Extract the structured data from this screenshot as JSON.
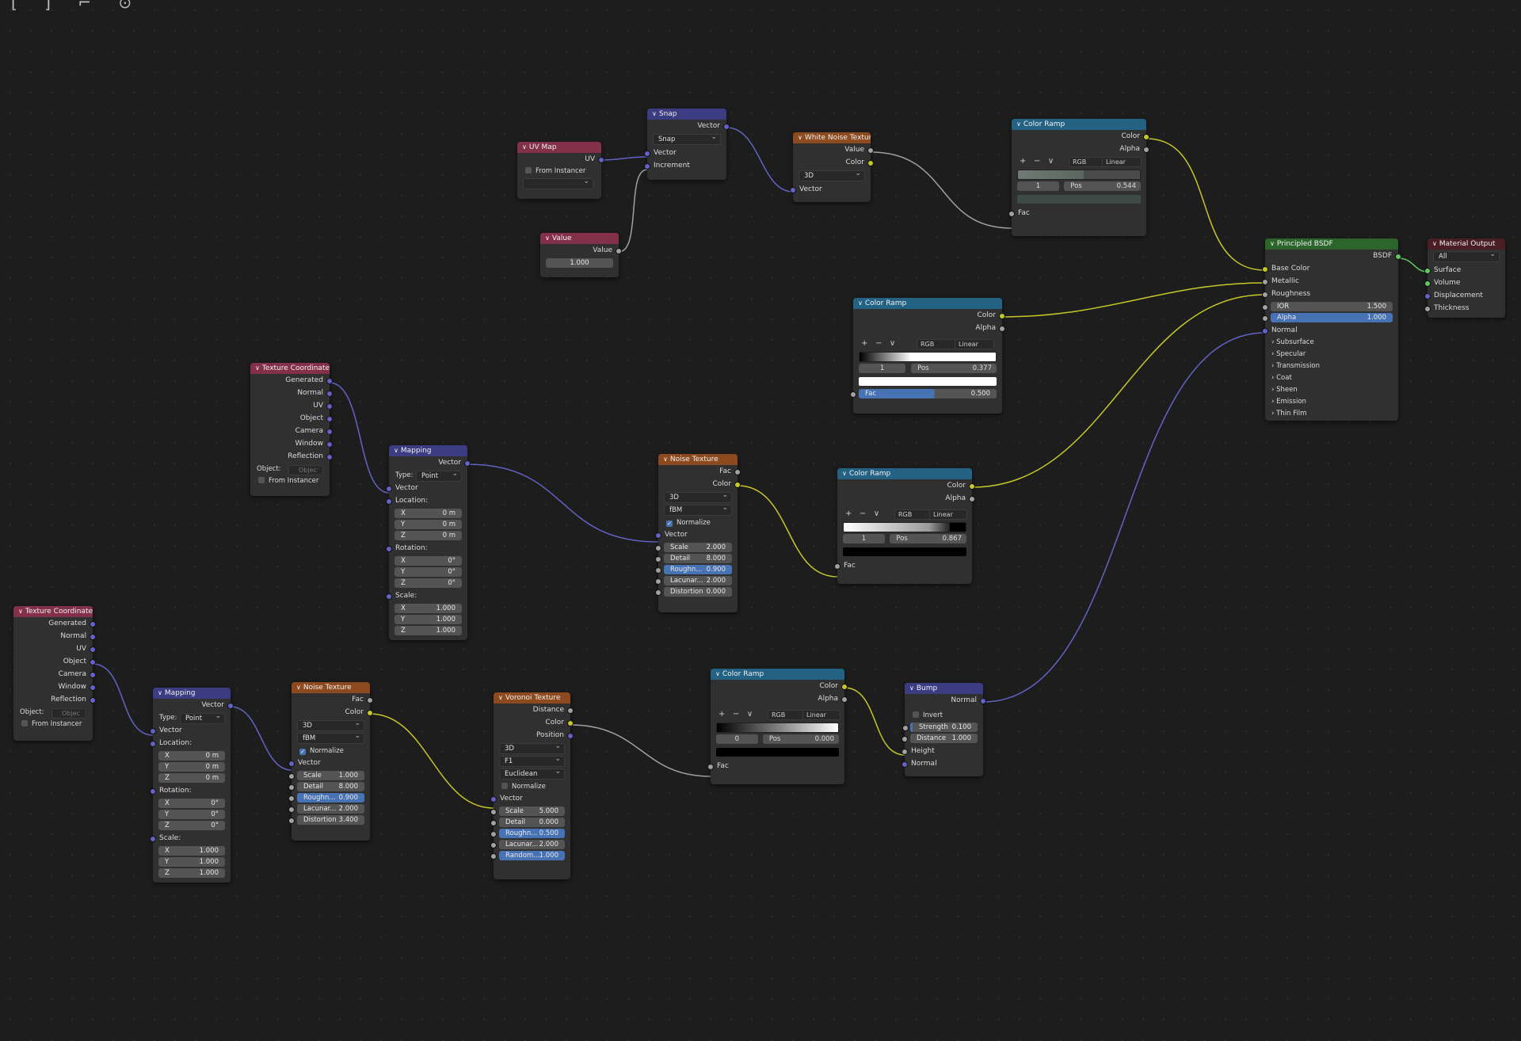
{
  "toolbar": {
    "icons": "[ ] ⌐ ⊙"
  },
  "colors": {
    "vector": "#6363c7",
    "color": "#c7c729",
    "float": "#a1a1a1",
    "shader": "#63c763"
  },
  "uvmap": {
    "title": "UV Map",
    "out_uv": "UV",
    "from_instancer": "From Instancer"
  },
  "value_node": {
    "title": "Value",
    "out_value": "Value",
    "value": "1.000"
  },
  "snap": {
    "title": "Snap",
    "out_vector": "Vector",
    "op": "Snap",
    "in_vector": "Vector",
    "in_increment": "Increment"
  },
  "whitenoise": {
    "title": "White Noise Texture",
    "out_value": "Value",
    "out_color": "Color",
    "dim": "3D",
    "in_vector": "Vector"
  },
  "ramp1": {
    "title": "Color Ramp",
    "out_color": "Color",
    "out_alpha": "Alpha",
    "plus": "+",
    "minus": "−",
    "mode": "RGB",
    "interp": "Linear",
    "index": "1",
    "pos_label": "Pos",
    "pos": "0.544",
    "in_fac": "Fac"
  },
  "ramp2": {
    "title": "Color Ramp",
    "out_color": "Color",
    "out_alpha": "Alpha",
    "plus": "+",
    "minus": "−",
    "mode": "RGB",
    "interp": "Linear",
    "index": "1",
    "pos_label": "Pos",
    "pos": "0.377",
    "in_fac": "Fac",
    "fac_value": "0.500"
  },
  "ramp3": {
    "title": "Color Ramp",
    "out_color": "Color",
    "out_alpha": "Alpha",
    "plus": "+",
    "minus": "−",
    "mode": "RGB",
    "interp": "Linear",
    "index": "1",
    "pos_label": "Pos",
    "pos": "0.867",
    "in_fac": "Fac"
  },
  "ramp4": {
    "title": "Color Ramp",
    "out_color": "Color",
    "out_alpha": "Alpha",
    "plus": "+",
    "minus": "−",
    "mode": "RGB",
    "interp": "Linear",
    "index": "0",
    "pos_label": "Pos",
    "pos": "0.000",
    "in_fac": "Fac"
  },
  "bsdf": {
    "title": "Principled BSDF",
    "out_bsdf": "BSDF",
    "base_color": "Base Color",
    "metallic": "Metallic",
    "roughness": "Roughness",
    "ior_label": "IOR",
    "ior": "1.500",
    "alpha_label": "Alpha",
    "alpha": "1.000",
    "normal": "Normal",
    "sections": [
      "Subsurface",
      "Specular",
      "Transmission",
      "Coat",
      "Sheen",
      "Emission",
      "Thin Film"
    ]
  },
  "matout": {
    "title": "Material Output",
    "target": "All",
    "surface": "Surface",
    "volume": "Volume",
    "displacement": "Displacement",
    "thickness": "Thickness"
  },
  "texcoord1": {
    "title": "Texture Coordinate",
    "outputs": [
      "Generated",
      "Normal",
      "UV",
      "Object",
      "Camera",
      "Window",
      "Reflection"
    ],
    "object_label": "Object:",
    "object_placeholder": "Objec",
    "from_instancer": "From Instancer"
  },
  "texcoord2": {
    "title": "Texture Coordinate",
    "outputs": [
      "Generated",
      "Normal",
      "UV",
      "Object",
      "Camera",
      "Window",
      "Reflection"
    ],
    "object_label": "Object:",
    "object_placeholder": "Objec",
    "from_instancer": "From Instancer"
  },
  "mapping1": {
    "title": "Mapping",
    "out_vector": "Vector",
    "type_label": "Type:",
    "type": "Point",
    "in_vector": "Vector",
    "location_label": "Location:",
    "location": [
      [
        "X",
        "0 m"
      ],
      [
        "Y",
        "0 m"
      ],
      [
        "Z",
        "0 m"
      ]
    ],
    "rotation_label": "Rotation:",
    "rotation": [
      [
        "X",
        "0°"
      ],
      [
        "Y",
        "0°"
      ],
      [
        "Z",
        "0°"
      ]
    ],
    "scale_label": "Scale:",
    "scale": [
      [
        "X",
        "1.000"
      ],
      [
        "Y",
        "1.000"
      ],
      [
        "Z",
        "1.000"
      ]
    ]
  },
  "mapping2": {
    "title": "Mapping",
    "out_vector": "Vector",
    "type_label": "Type:",
    "type": "Point",
    "in_vector": "Vector",
    "location_label": "Location:",
    "location": [
      [
        "X",
        "0 m"
      ],
      [
        "Y",
        "0 m"
      ],
      [
        "Z",
        "0 m"
      ]
    ],
    "rotation_label": "Rotation:",
    "rotation": [
      [
        "X",
        "0°"
      ],
      [
        "Y",
        "0°"
      ],
      [
        "Z",
        "0°"
      ]
    ],
    "scale_label": "Scale:",
    "scale": [
      [
        "X",
        "1.000"
      ],
      [
        "Y",
        "1.000"
      ],
      [
        "Z",
        "1.000"
      ]
    ]
  },
  "noise1": {
    "title": "Noise Texture",
    "out_fac": "Fac",
    "out_color": "Color",
    "dim": "3D",
    "type": "fBM",
    "normalize": "Normalize",
    "in_vector": "Vector",
    "params": [
      [
        "Scale",
        "2.000"
      ],
      [
        "Detail",
        "8.000"
      ],
      [
        "Roughn...",
        "0.900"
      ],
      [
        "Lacunar...",
        "2.000"
      ],
      [
        "Distortion",
        "0.000"
      ]
    ]
  },
  "noise2": {
    "title": "Noise Texture",
    "out_fac": "Fac",
    "out_color": "Color",
    "dim": "3D",
    "type": "fBM",
    "normalize": "Normalize",
    "in_vector": "Vector",
    "params": [
      [
        "Scale",
        "1.000"
      ],
      [
        "Detail",
        "8.000"
      ],
      [
        "Roughn...",
        "0.900"
      ],
      [
        "Lacunar...",
        "2.000"
      ],
      [
        "Distortion",
        "3.400"
      ]
    ]
  },
  "voronoi": {
    "title": "Voronoi Texture",
    "out_distance": "Distance",
    "out_color": "Color",
    "out_position": "Position",
    "dim": "3D",
    "feature": "F1",
    "metric": "Euclidean",
    "normalize": "Normalize",
    "in_vector": "Vector",
    "params": [
      [
        "Scale",
        "5.000"
      ],
      [
        "Detail",
        "0.000"
      ],
      [
        "Roughn...",
        "0.500"
      ],
      [
        "Lacunar...",
        "2.000"
      ],
      [
        "Random...",
        "1.000"
      ]
    ]
  },
  "bump": {
    "title": "Bump",
    "out_normal": "Normal",
    "invert": "Invert",
    "strength_label": "Strength",
    "strength": "0.100",
    "distance_label": "Distance",
    "distance": "1.000",
    "in_height": "Height",
    "in_normal": "Normal"
  }
}
